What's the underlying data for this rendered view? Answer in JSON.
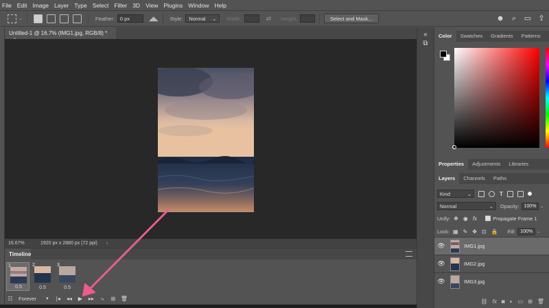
{
  "menu": [
    "File",
    "Edit",
    "Image",
    "Layer",
    "Type",
    "Select",
    "Filter",
    "3D",
    "View",
    "Plugins",
    "Window",
    "Help"
  ],
  "options": {
    "feather_label": "Feather:",
    "feather_value": "0 px",
    "style_label": "Style:",
    "style_value": "Normal",
    "width_label": "Width:",
    "height_label": "Height:",
    "select_mask_label": "Select and Mask..."
  },
  "document": {
    "tab_title": "Untitled-1 @ 16.7% (IMG1.jpg, RGB/8) *",
    "close": "×"
  },
  "status": {
    "zoom": "16.67%",
    "info": "1920 px x 2880 px (72 ppi)",
    "chevron": "›"
  },
  "timeline": {
    "tab": "Timeline",
    "frames": [
      {
        "num": "1",
        "delay": "0.5"
      },
      {
        "num": "2",
        "delay": "0.5"
      },
      {
        "num": "3",
        "delay": "0.5"
      }
    ],
    "loop": "Forever"
  },
  "color_panel": {
    "tabs": [
      "Color",
      "Swatches",
      "Gradients",
      "Patterns"
    ],
    "active": "Color"
  },
  "properties_panel": {
    "tabs": [
      "Properties",
      "Adjustments",
      "Libraries"
    ]
  },
  "layers_panel": {
    "tabs": [
      "Layers",
      "Channels",
      "Paths"
    ],
    "kind": "Kind",
    "blend_mode": "Normal",
    "opacity_label": "Opacity:",
    "opacity_value": "100%",
    "unify_label": "Unify:",
    "propagate_label": "Propagate Frame 1",
    "lock_label": "Lock:",
    "fill_label": "Fill:",
    "fill_value": "100%",
    "layers": [
      {
        "name": "IMG1.jpg",
        "selected": true
      },
      {
        "name": "IMG2.jpg",
        "selected": false
      },
      {
        "name": "IMG3.jpg",
        "selected": false
      }
    ]
  },
  "colors": {
    "accent_arrow": "#ee5b8f",
    "panel_bg": "#535353",
    "canvas_bg": "#282828"
  }
}
